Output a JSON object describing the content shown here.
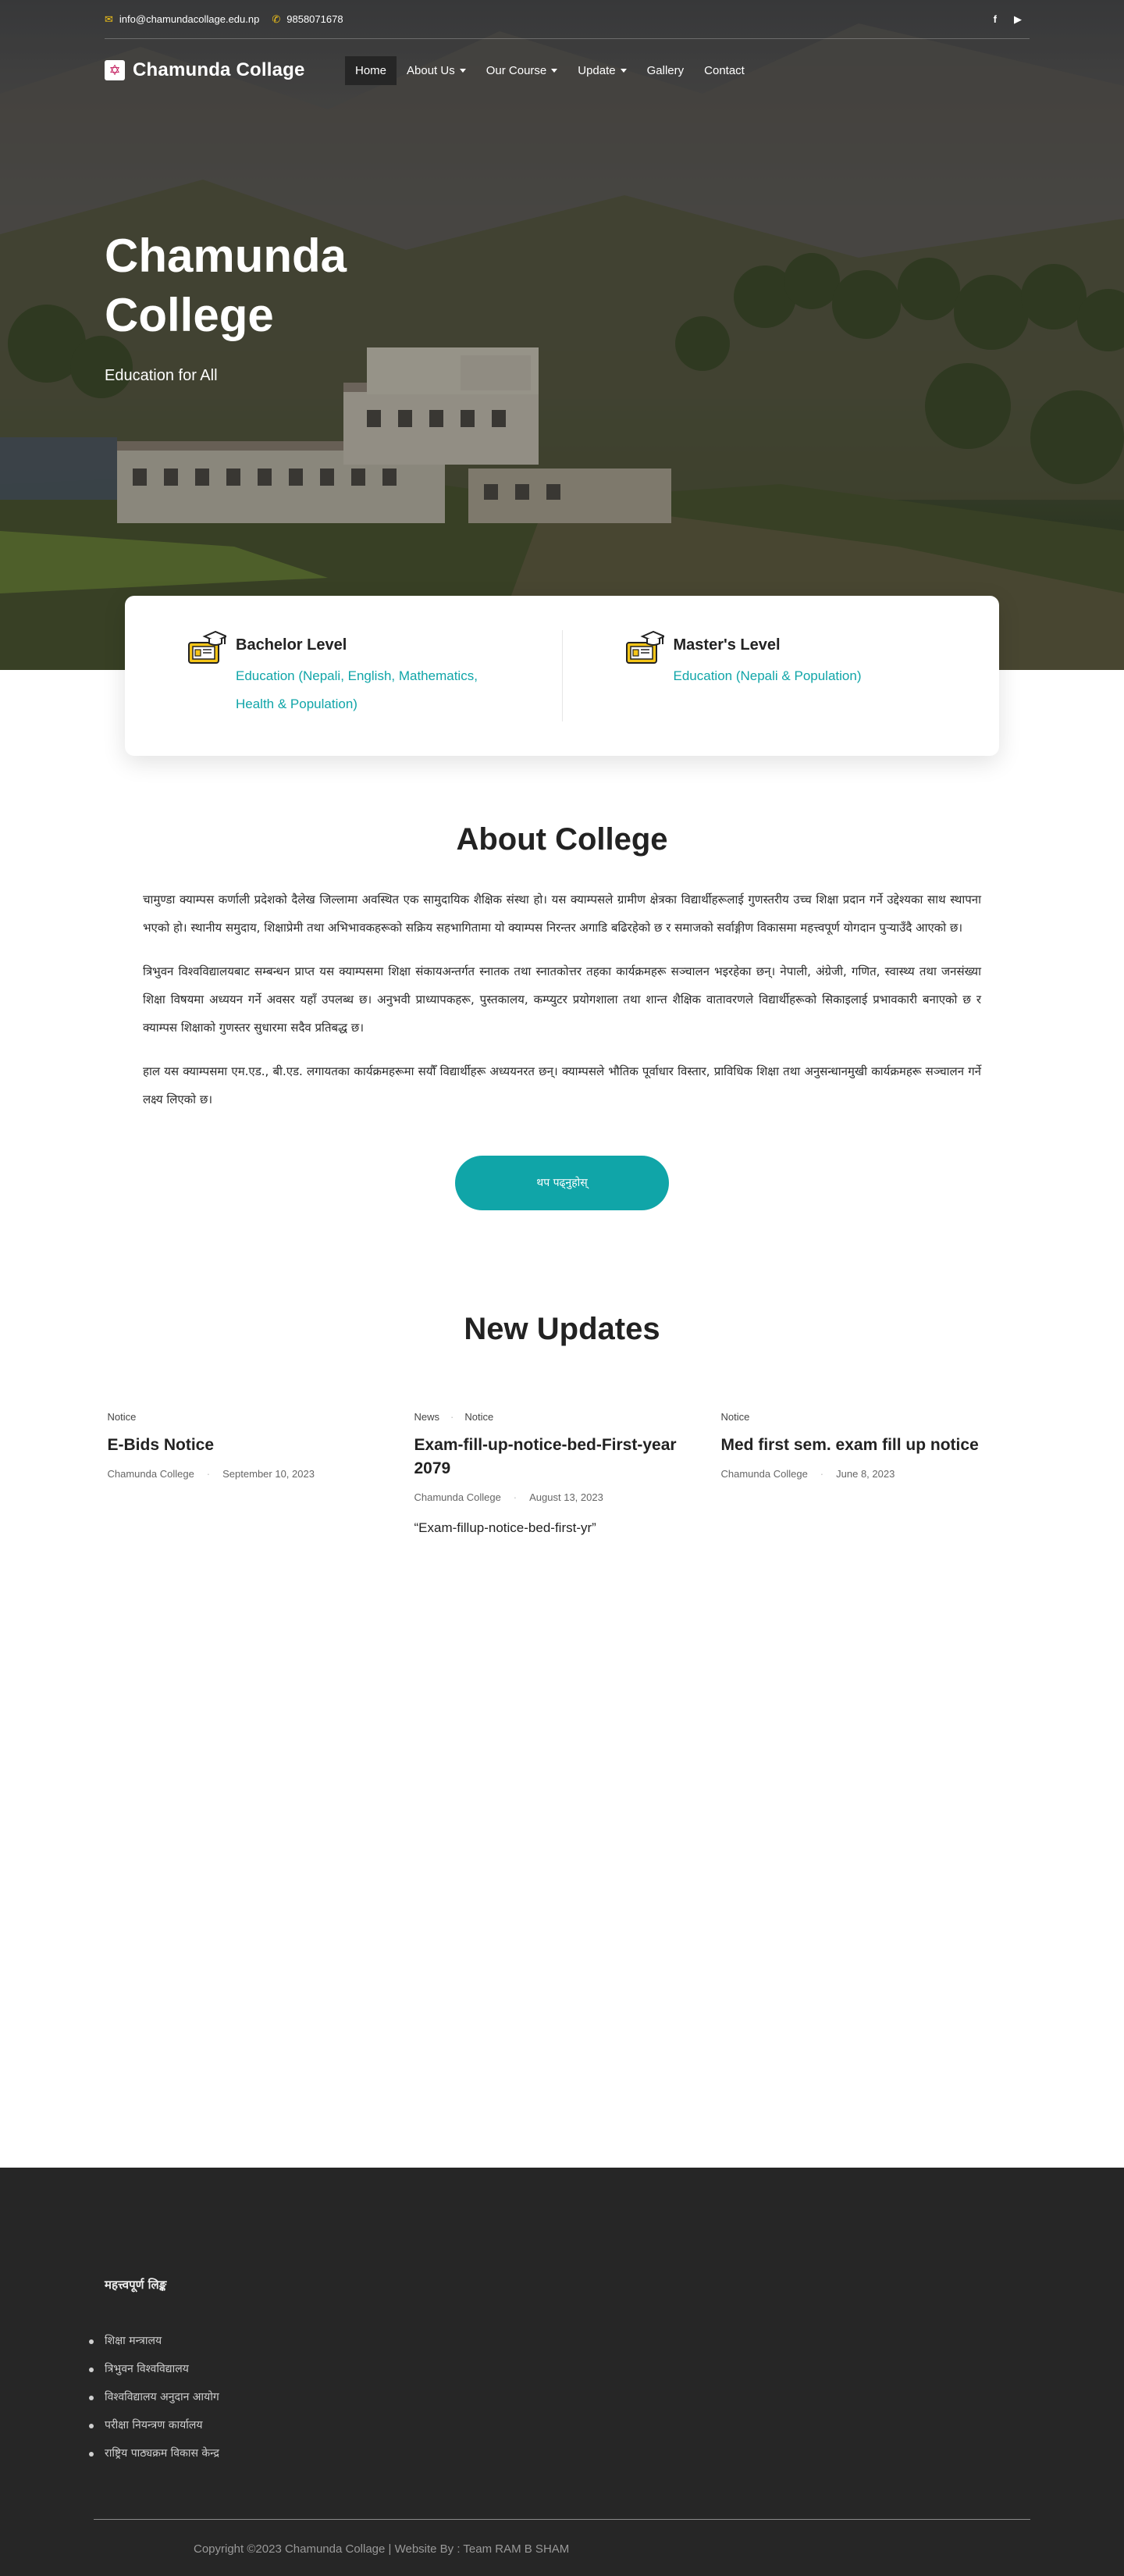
{
  "topbar": {
    "email": "info@chamundacollage.edu.np",
    "phone": "9858071678",
    "social": [
      "facebook-icon",
      "youtube-icon"
    ]
  },
  "navbar": {
    "brand": "Chamunda Collage",
    "menu": [
      {
        "label": "Home",
        "active": true,
        "dropdown": false
      },
      {
        "label": "About Us",
        "active": false,
        "dropdown": true
      },
      {
        "label": "Our Course",
        "active": false,
        "dropdown": true
      },
      {
        "label": "Update",
        "active": false,
        "dropdown": true
      },
      {
        "label": "Gallery",
        "active": false,
        "dropdown": false
      },
      {
        "label": "Contact",
        "active": false,
        "dropdown": false
      }
    ]
  },
  "hero": {
    "title": "Chamunda College",
    "subtitle": "Education for All"
  },
  "levels": [
    {
      "title": "Bachelor Level",
      "description": "Education (Nepali, English, Mathematics, Health & Population)"
    },
    {
      "title": "Master's Level",
      "description": "Education (Nepali & Population)"
    }
  ],
  "about": {
    "title": "About College",
    "paragraphs": [
      "चामुण्डा क्याम्पस कर्णाली प्रदेशको दैलेख जिल्लामा अवस्थित एक सामुदायिक शैक्षिक संस्था हो। यस क्याम्पसले ग्रामीण क्षेत्रका विद्यार्थीहरूलाई गुणस्तरीय उच्च शिक्षा प्रदान गर्ने उद्देश्यका साथ स्थापना भएको हो। स्थानीय समुदाय, शिक्षाप्रेमी तथा अभिभावकहरूको सक्रिय सहभागितामा यो क्याम्पस निरन्तर अगाडि बढिरहेको छ र समाजको सर्वाङ्गीण विकासमा महत्त्वपूर्ण योगदान पुर्‍याउँदै आएको छ।",
      "त्रिभुवन विश्वविद्यालयबाट सम्बन्धन प्राप्त यस क्याम्पसमा शिक्षा संकायअन्तर्गत स्नातक तथा स्नातकोत्तर तहका कार्यक्रमहरू सञ्चालन भइरहेका छन्। नेपाली, अंग्रेजी, गणित, स्वास्थ्य तथा जनसंख्या शिक्षा विषयमा अध्ययन गर्ने अवसर यहाँ उपलब्ध छ। अनुभवी प्राध्यापकहरू, पुस्तकालय, कम्प्युटर प्रयोगशाला तथा शान्त शैक्षिक वातावरणले विद्यार्थीहरूको सिकाइलाई प्रभावकारी बनाएको छ र क्याम्पस शिक्षाको गुणस्तर सुधारमा सदैव प्रतिबद्ध छ।",
      "हाल यस क्याम्पसमा एम.एड., बी.एड. लगायतका कार्यक्रमहरूमा सयौँ विद्यार्थीहरू अध्ययनरत छन्। क्याम्पसले भौतिक पूर्वाधार विस्तार, प्राविधिक शिक्षा तथा अनुसन्धानमुखी कार्यक्रमहरू सञ्चालन गर्ने लक्ष्य लिएको छ।"
    ],
    "button_label": "थप पढ्नुहोस्"
  },
  "updates": {
    "title": "New Updates",
    "items": [
      {
        "tags": [
          "Notice"
        ],
        "title": "E-Bids Notice",
        "author": "Chamunda College",
        "date": "September 10, 2023",
        "excerpt": ""
      },
      {
        "tags": [
          "News",
          "Notice"
        ],
        "title": "Exam-fill-up-notice-bed-First-year 2079",
        "author": "Chamunda College",
        "date": "August 13, 2023",
        "excerpt": "“Exam-fillup-notice-bed-first-yr”"
      },
      {
        "tags": [
          "Notice"
        ],
        "title": "Med first sem. exam fill up notice",
        "author": "Chamunda College",
        "date": "June 8, 2023",
        "excerpt": ""
      }
    ]
  },
  "footer": {
    "heading": "महत्त्वपूर्ण लिङ्क",
    "links": [
      "शिक्षा मन्त्रालय",
      "त्रिभुवन विश्वविद्यालय",
      "विश्वविद्यालय अनुदान आयोग",
      "परीक्षा नियन्त्रण कार्यालय",
      "राष्ट्रिय पाठ्यक्रम विकास केन्द्र"
    ],
    "copyright": "Copyright ©2023 Chamunda Collage | Website By : Team RAM B SHAM"
  },
  "colors": {
    "accent": "#10a5a8",
    "topbar_icon": "#f5c518",
    "nav_active_bg": "#262626",
    "footer_bg": "#262626"
  }
}
